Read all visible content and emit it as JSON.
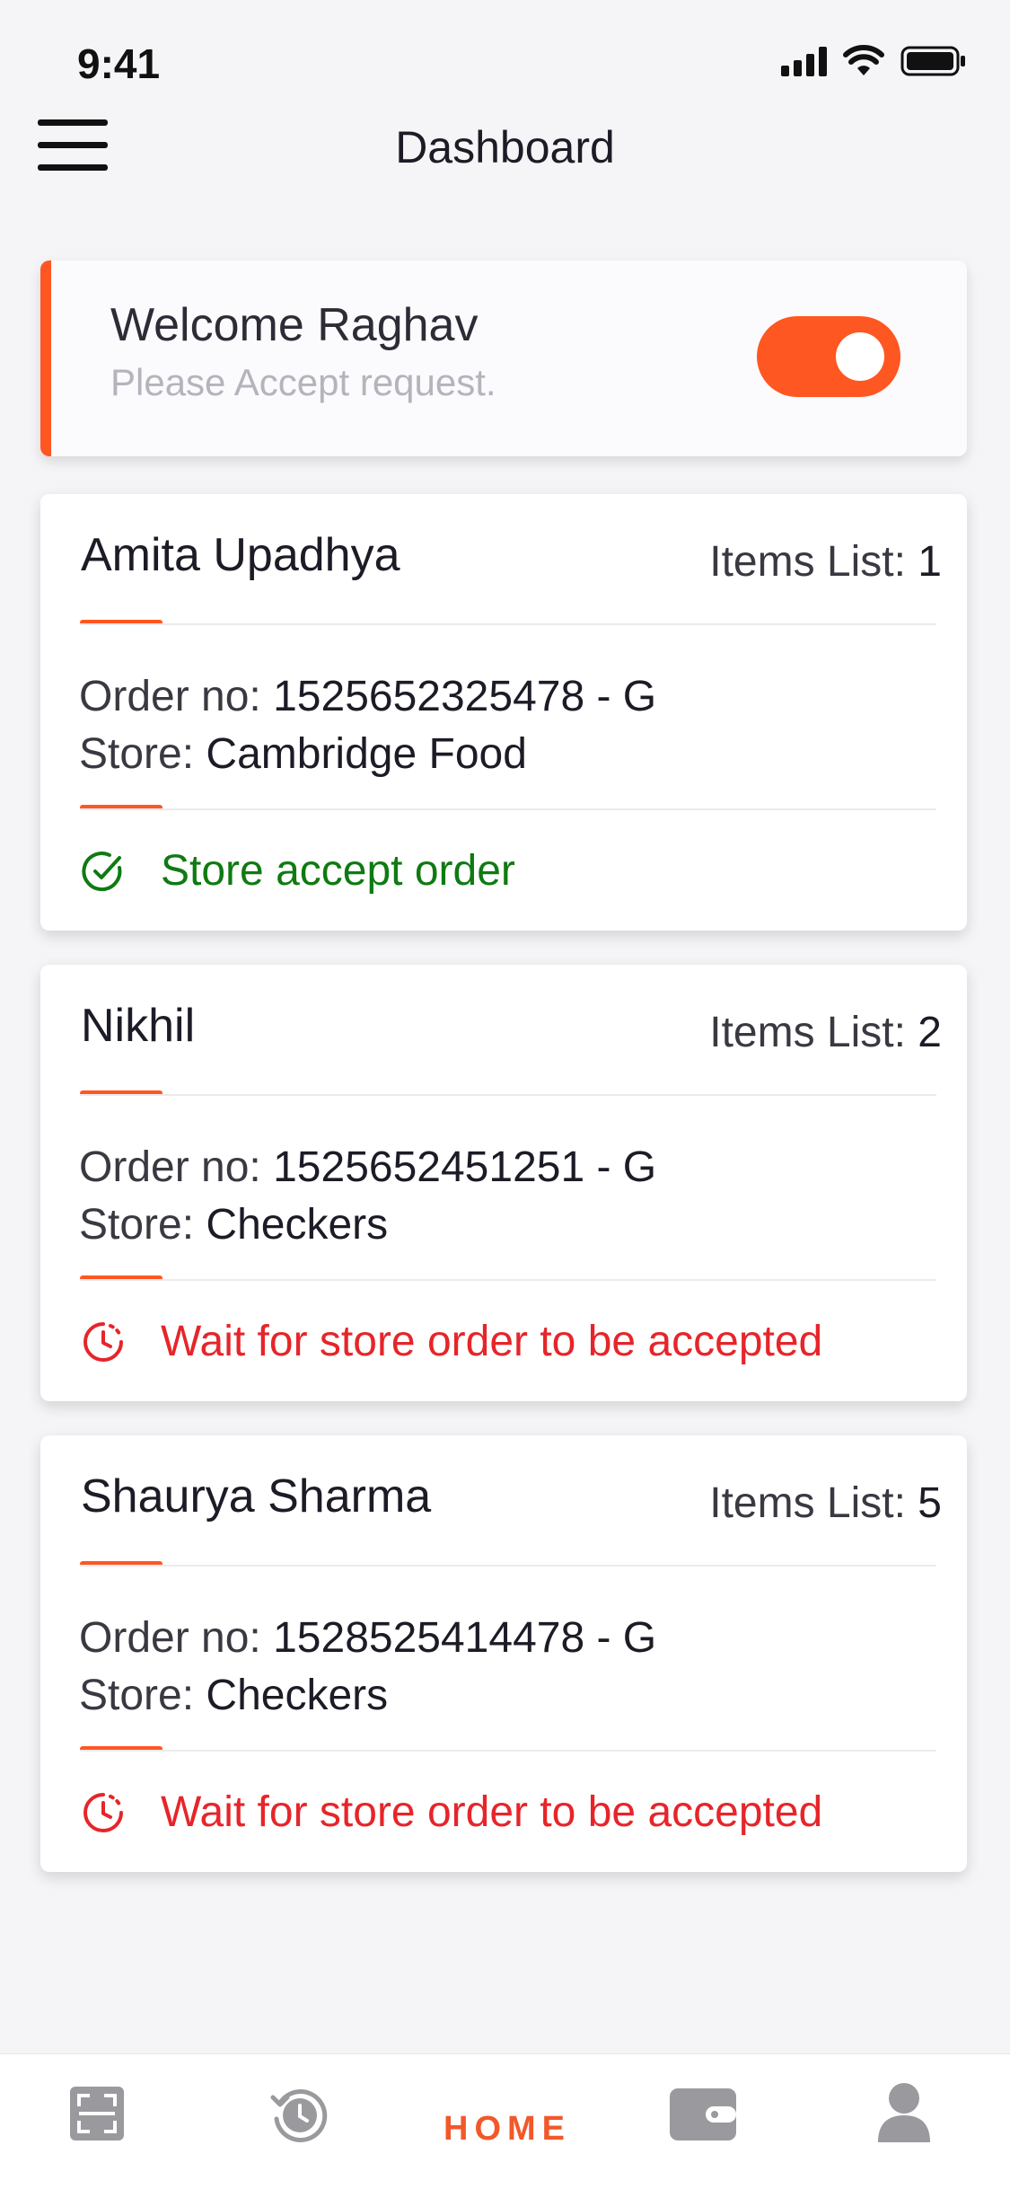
{
  "status_bar": {
    "time": "9:41",
    "icons": [
      "signal-icon",
      "wifi-icon",
      "battery-icon"
    ]
  },
  "header": {
    "title": "Dashboard",
    "menu_icon": "hamburger-menu-icon"
  },
  "welcome": {
    "greeting": "Welcome Raghav",
    "subtitle": "Please Accept request.",
    "toggle_on": true
  },
  "orders": [
    {
      "customer": "Amita Upadhya",
      "items_label": "Items List:",
      "items_count": "1",
      "order_label": "Order no:",
      "order_no": "1525652325478 - G",
      "store_label": "Store:",
      "store": "Cambridge Food",
      "status": "Store accept order",
      "status_type": "accepted",
      "status_icon": "check-circle-icon"
    },
    {
      "customer": "Nikhil",
      "items_label": "Items List:",
      "items_count": "2",
      "order_label": "Order no:",
      "order_no": "1525652451251 - G",
      "store_label": "Store:",
      "store": "Checkers",
      "status": "Wait for store order to be accepted",
      "status_type": "waiting",
      "status_icon": "clock-pending-icon"
    },
    {
      "customer": "Shaurya Sharma",
      "items_label": "Items List:",
      "items_count": "5",
      "order_label": "Order no:",
      "order_no": "1528525414478 - G",
      "store_label": "Store:",
      "store": "Checkers",
      "status": "Wait for store order to be accepted",
      "status_type": "waiting",
      "status_icon": "clock-pending-icon"
    }
  ],
  "tabbar": {
    "active": "home",
    "home_label": "HOME",
    "icons": [
      "scan-icon",
      "history-icon",
      "home",
      "wallet-icon",
      "profile-icon"
    ]
  },
  "colors": {
    "accent": "#ff5722",
    "accepted": "#0f7a12",
    "waiting": "#e6252a",
    "inactive_icon": "#9a9a9e"
  }
}
